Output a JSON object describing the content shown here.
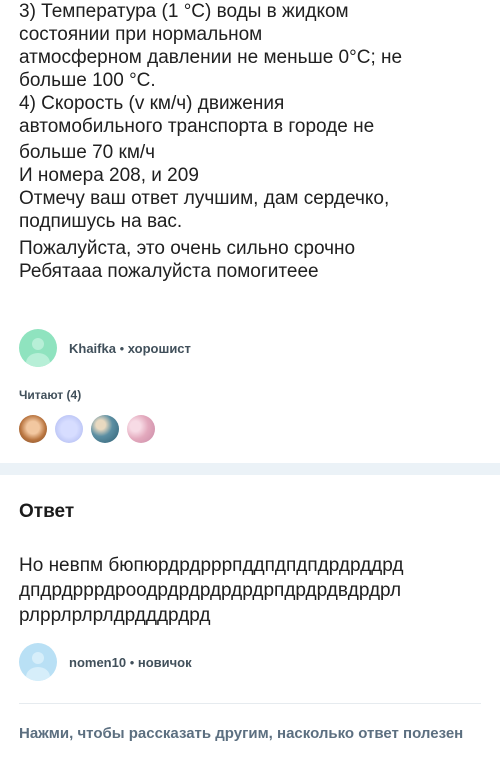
{
  "question": {
    "lines": [
      "3) Температура (1 °С) воды в жидком",
      "состоянии при нормальном",
      "атмосферном давлении не меньше 0°С; не",
      "больше 100 °С.",
      "4) Скорость (v км/ч) движения",
      "автомобильного транспорта в городе не",
      "больше 70 км/ч",
      "И номера 208, и 209",
      "Отмечу ваш ответ лучшим, дам сердечко,",
      "подпишусь на вас.",
      "Пожалуйста, это очень сильно срочно",
      "Ребятааа пожалуйста помогитеее"
    ]
  },
  "asker": {
    "name": "Khaifka",
    "separator": " • ",
    "rank": "хорошист",
    "avatar_color": "#8fe3bf"
  },
  "readers": {
    "label": "Читают (4)",
    "avatars": [
      "#d8a27a",
      "#b9c3f5",
      "#6f9fb0",
      "#e7b7c8"
    ]
  },
  "answer": {
    "title": "Ответ",
    "lines": [
      "Но невпм бюпюрдрдрррпддпдпдпдрдрддрд",
      "дпдрдрррдроодрдрдрдрдрдрпдрдрдвдрдрл",
      "рлррлрлрлдрдддрдрд"
    ]
  },
  "answerer": {
    "name": "nomen10",
    "separator": " • ",
    "rank": "новичок",
    "avatar_color": "#b9e0f5"
  },
  "footer": {
    "helpful_prompt": "Нажми, чтобы рассказать другим, насколько ответ полезен"
  }
}
